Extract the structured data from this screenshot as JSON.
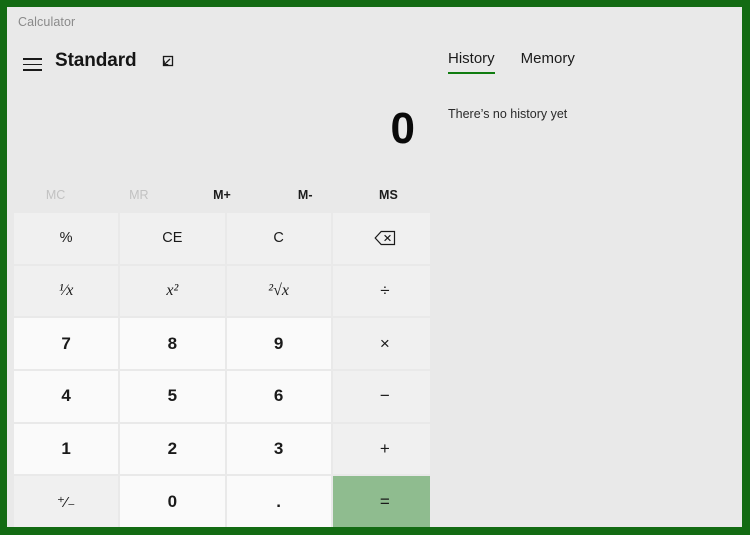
{
  "window": {
    "title": "Calculator",
    "frame_color": "#136b13",
    "background": "#e9e9e9",
    "caption_buttons": [
      {
        "name": "minimize",
        "glyph": "minimize-icon"
      },
      {
        "name": "maximize",
        "glyph": "maximize-icon"
      },
      {
        "name": "close",
        "glyph": "close-icon"
      }
    ]
  },
  "header": {
    "menu_icon": "hamburger-menu-icon",
    "mode_title": "Standard",
    "keep_on_top_icon": "keep-on-top-icon"
  },
  "display": {
    "expression": "",
    "value": "0"
  },
  "memory": {
    "buttons": [
      {
        "label": "MC",
        "enabled": false
      },
      {
        "label": "MR",
        "enabled": false
      },
      {
        "label": "M+",
        "enabled": true
      },
      {
        "label": "M-",
        "enabled": true
      },
      {
        "label": "MS",
        "enabled": true
      }
    ]
  },
  "keypad": {
    "rows": [
      [
        {
          "label": "%",
          "name": "percent",
          "kind": "func"
        },
        {
          "label": "CE",
          "name": "clear-entry",
          "kind": "func"
        },
        {
          "label": "C",
          "name": "clear",
          "kind": "func"
        },
        {
          "label": "",
          "name": "backspace",
          "kind": "func",
          "icon": "backspace-icon"
        }
      ],
      [
        {
          "label": "¹⁄x",
          "name": "reciprocal",
          "kind": "math"
        },
        {
          "label": "x²",
          "name": "square",
          "kind": "math"
        },
        {
          "label": "²√x",
          "name": "square-root",
          "kind": "math"
        },
        {
          "label": "÷",
          "name": "divide",
          "kind": "op"
        }
      ],
      [
        {
          "label": "7",
          "name": "digit-7",
          "kind": "digit"
        },
        {
          "label": "8",
          "name": "digit-8",
          "kind": "digit"
        },
        {
          "label": "9",
          "name": "digit-9",
          "kind": "digit"
        },
        {
          "label": "×",
          "name": "multiply",
          "kind": "op"
        }
      ],
      [
        {
          "label": "4",
          "name": "digit-4",
          "kind": "digit"
        },
        {
          "label": "5",
          "name": "digit-5",
          "kind": "digit"
        },
        {
          "label": "6",
          "name": "digit-6",
          "kind": "digit"
        },
        {
          "label": "−",
          "name": "subtract",
          "kind": "op"
        }
      ],
      [
        {
          "label": "1",
          "name": "digit-1",
          "kind": "digit"
        },
        {
          "label": "2",
          "name": "digit-2",
          "kind": "digit"
        },
        {
          "label": "3",
          "name": "digit-3",
          "kind": "digit"
        },
        {
          "label": "+",
          "name": "add",
          "kind": "op"
        }
      ],
      [
        {
          "label": "⁺⁄₋",
          "name": "sign-flip",
          "kind": "signflip"
        },
        {
          "label": "0",
          "name": "digit-0",
          "kind": "digit"
        },
        {
          "label": ".",
          "name": "decimal-point",
          "kind": "digit"
        },
        {
          "label": "=",
          "name": "equals",
          "kind": "equals"
        }
      ]
    ]
  },
  "side_panel": {
    "tabs": [
      {
        "label": "History",
        "active": true
      },
      {
        "label": "Memory",
        "active": false
      }
    ],
    "empty_text": "There’s no history yet",
    "accent_color": "#107c10"
  }
}
